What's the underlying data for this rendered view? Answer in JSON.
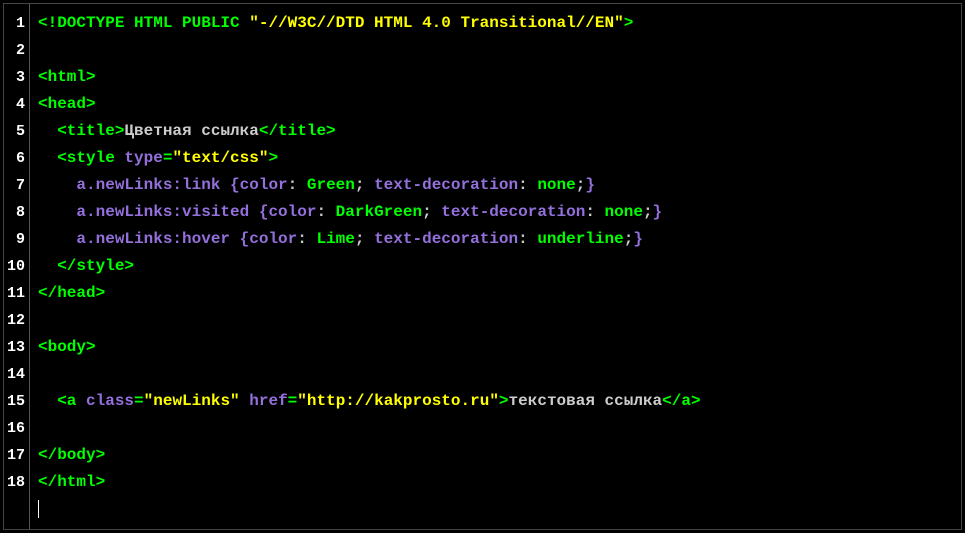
{
  "lineCount": 18,
  "lines": [
    [
      {
        "cls": "tag",
        "t": "<!DOCTYPE HTML PUBLIC "
      },
      {
        "cls": "string",
        "t": "\"-//W3C//DTD HTML 4.0 Transitional//EN\""
      },
      {
        "cls": "tag",
        "t": ">"
      }
    ],
    [],
    [
      {
        "cls": "tag",
        "t": "<html>"
      }
    ],
    [
      {
        "cls": "tag",
        "t": "<head>"
      }
    ],
    [
      {
        "cls": "text",
        "t": "  "
      },
      {
        "cls": "tag",
        "t": "<title>"
      },
      {
        "cls": "text",
        "t": "Цветная ссылка"
      },
      {
        "cls": "tag",
        "t": "</title>"
      }
    ],
    [
      {
        "cls": "text",
        "t": "  "
      },
      {
        "cls": "tag",
        "t": "<style "
      },
      {
        "cls": "attr",
        "t": "type"
      },
      {
        "cls": "tag",
        "t": "="
      },
      {
        "cls": "string",
        "t": "\"text/css\""
      },
      {
        "cls": "tag",
        "t": ">"
      }
    ],
    [
      {
        "cls": "text",
        "t": "    "
      },
      {
        "cls": "attr",
        "t": "a.newLinks:link "
      },
      {
        "cls": "brace",
        "t": "{"
      },
      {
        "cls": "prop",
        "t": "color"
      },
      {
        "cls": "text",
        "t": ": "
      },
      {
        "cls": "val",
        "t": "Green"
      },
      {
        "cls": "text",
        "t": "; "
      },
      {
        "cls": "prop",
        "t": "text-decoration"
      },
      {
        "cls": "text",
        "t": ": "
      },
      {
        "cls": "val",
        "t": "none"
      },
      {
        "cls": "text",
        "t": ";"
      },
      {
        "cls": "brace",
        "t": "}"
      }
    ],
    [
      {
        "cls": "text",
        "t": "    "
      },
      {
        "cls": "attr",
        "t": "a.newLinks:visited "
      },
      {
        "cls": "brace",
        "t": "{"
      },
      {
        "cls": "prop",
        "t": "color"
      },
      {
        "cls": "text",
        "t": ": "
      },
      {
        "cls": "val",
        "t": "DarkGreen"
      },
      {
        "cls": "text",
        "t": "; "
      },
      {
        "cls": "prop",
        "t": "text-decoration"
      },
      {
        "cls": "text",
        "t": ": "
      },
      {
        "cls": "val",
        "t": "none"
      },
      {
        "cls": "text",
        "t": ";"
      },
      {
        "cls": "brace",
        "t": "}"
      }
    ],
    [
      {
        "cls": "text",
        "t": "    "
      },
      {
        "cls": "attr",
        "t": "a.newLinks:hover "
      },
      {
        "cls": "brace",
        "t": "{"
      },
      {
        "cls": "prop",
        "t": "color"
      },
      {
        "cls": "text",
        "t": ": "
      },
      {
        "cls": "val",
        "t": "Lime"
      },
      {
        "cls": "text",
        "t": "; "
      },
      {
        "cls": "prop",
        "t": "text-decoration"
      },
      {
        "cls": "text",
        "t": ": "
      },
      {
        "cls": "val",
        "t": "underline"
      },
      {
        "cls": "text",
        "t": ";"
      },
      {
        "cls": "brace",
        "t": "}"
      }
    ],
    [
      {
        "cls": "text",
        "t": "  "
      },
      {
        "cls": "tag",
        "t": "</style>"
      }
    ],
    [
      {
        "cls": "tag",
        "t": "</head>"
      }
    ],
    [],
    [
      {
        "cls": "tag",
        "t": "<body>"
      }
    ],
    [],
    [
      {
        "cls": "text",
        "t": "  "
      },
      {
        "cls": "tag",
        "t": "<a "
      },
      {
        "cls": "attr",
        "t": "class"
      },
      {
        "cls": "tag",
        "t": "="
      },
      {
        "cls": "string",
        "t": "\"newLinks\""
      },
      {
        "cls": "tag",
        "t": " "
      },
      {
        "cls": "attr",
        "t": "href"
      },
      {
        "cls": "tag",
        "t": "="
      },
      {
        "cls": "string",
        "t": "\"http://kakprosto.ru\""
      },
      {
        "cls": "tag",
        "t": ">"
      },
      {
        "cls": "text",
        "t": "текстовая ссылка"
      },
      {
        "cls": "tag",
        "t": "</a>"
      }
    ],
    [],
    [
      {
        "cls": "tag",
        "t": "</body>"
      }
    ],
    [
      {
        "cls": "tag",
        "t": "</html>"
      }
    ]
  ]
}
